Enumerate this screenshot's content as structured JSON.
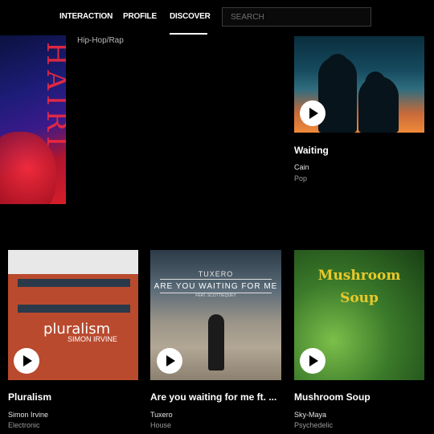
{
  "nav": {
    "items": [
      {
        "label": "INTERACTION"
      },
      {
        "label": "PROFILE"
      },
      {
        "label": "DISCOVER",
        "active": true
      }
    ],
    "search_placeholder": "SEARCH"
  },
  "top_row": {
    "partial_card": {
      "genre": "Hip-Hop/Rap",
      "cover_text": "HAIRI"
    },
    "waiting": {
      "title": "Waiting",
      "artist": "Cain",
      "genre": "Pop"
    }
  },
  "cards": [
    {
      "title": "Pluralism",
      "artist": "Simon Irvine",
      "genre": "Electronic",
      "cover_text": "pluralism",
      "cover_sub": "SIMON IRVINE"
    },
    {
      "title": "Are you waiting for me ft. ...",
      "artist": "Tuxero",
      "genre": "House",
      "cover_line1": "TUXERO",
      "cover_line2": "ARE YOU WAITING FOR ME",
      "cover_line3": "FEAT. SCOTTIEQUEY"
    },
    {
      "title": "Mushroom Soup",
      "artist": "Sky-Maya",
      "genre": "Psychedelic",
      "cover_line1": "Mushroom",
      "cover_line2": "Soup"
    }
  ],
  "colors": {
    "background": "#000000",
    "text": "#ffffff",
    "muted": "#9a9a9a"
  }
}
